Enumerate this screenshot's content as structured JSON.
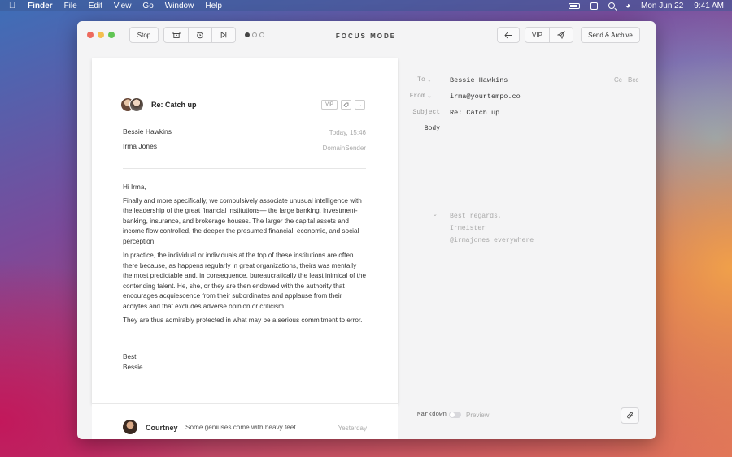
{
  "menubar": {
    "items": [
      "Finder",
      "File",
      "Edit",
      "View",
      "Go",
      "Window",
      "Help"
    ],
    "date": "Mon Jun 22",
    "time": "9:41 AM"
  },
  "toolbar": {
    "stop_label": "Stop",
    "title": "FOCUS MODE",
    "vip_label": "VIP",
    "send_archive_label": "Send & Archive"
  },
  "message": {
    "subject": "Re: Catch up",
    "tags": [
      "VIP"
    ],
    "from_name": "Bessie Hawkins",
    "to_name": "Irma Jones",
    "time": "Today, 15:46",
    "sender_domain": "DomainSender",
    "greeting": "Hi Irma,",
    "paragraphs": [
      "Finally and more specifically, we compulsively associate unusual intelligence with the leadership of the great financial institutions— the large banking, investment-banking, insurance, and brokerage houses. The larger the capital assets and income flow controlled, the deeper the presumed financial, economic, and social perception.",
      "In practice, the individual or individuals at the top of these institutions are often there because, as happens regularly in great organizations, theirs was mentally the most predictable and, in consequence, bureaucratically the least inimical of the contending talent. He, she, or they are then endowed with the authority that encourages acquiescence from their subordinates and applause from their acolytes and that excludes adverse opinion or criticism.",
      "They are thus admirably protected in what may be a serious commitment to error."
    ],
    "closing": "Best,",
    "signature": "Bessie"
  },
  "thread": {
    "name": "Courtney",
    "snippet": "Some geniuses come with heavy feet...",
    "time": "Yesterday"
  },
  "compose": {
    "to_label": "To",
    "to_value": "Bessie Hawkins",
    "cc_label": "Cc",
    "bcc_label": "Bcc",
    "from_label": "From",
    "from_value": "irma@yourtempo.co",
    "subject_label": "Subject",
    "subject_value": "Re: Catch up",
    "body_label": "Body",
    "signature_lines": [
      "Best regards,",
      "Irmeister",
      "@irmajones everywhere"
    ],
    "markdown_label": "Markdown",
    "preview_label": "Preview"
  }
}
